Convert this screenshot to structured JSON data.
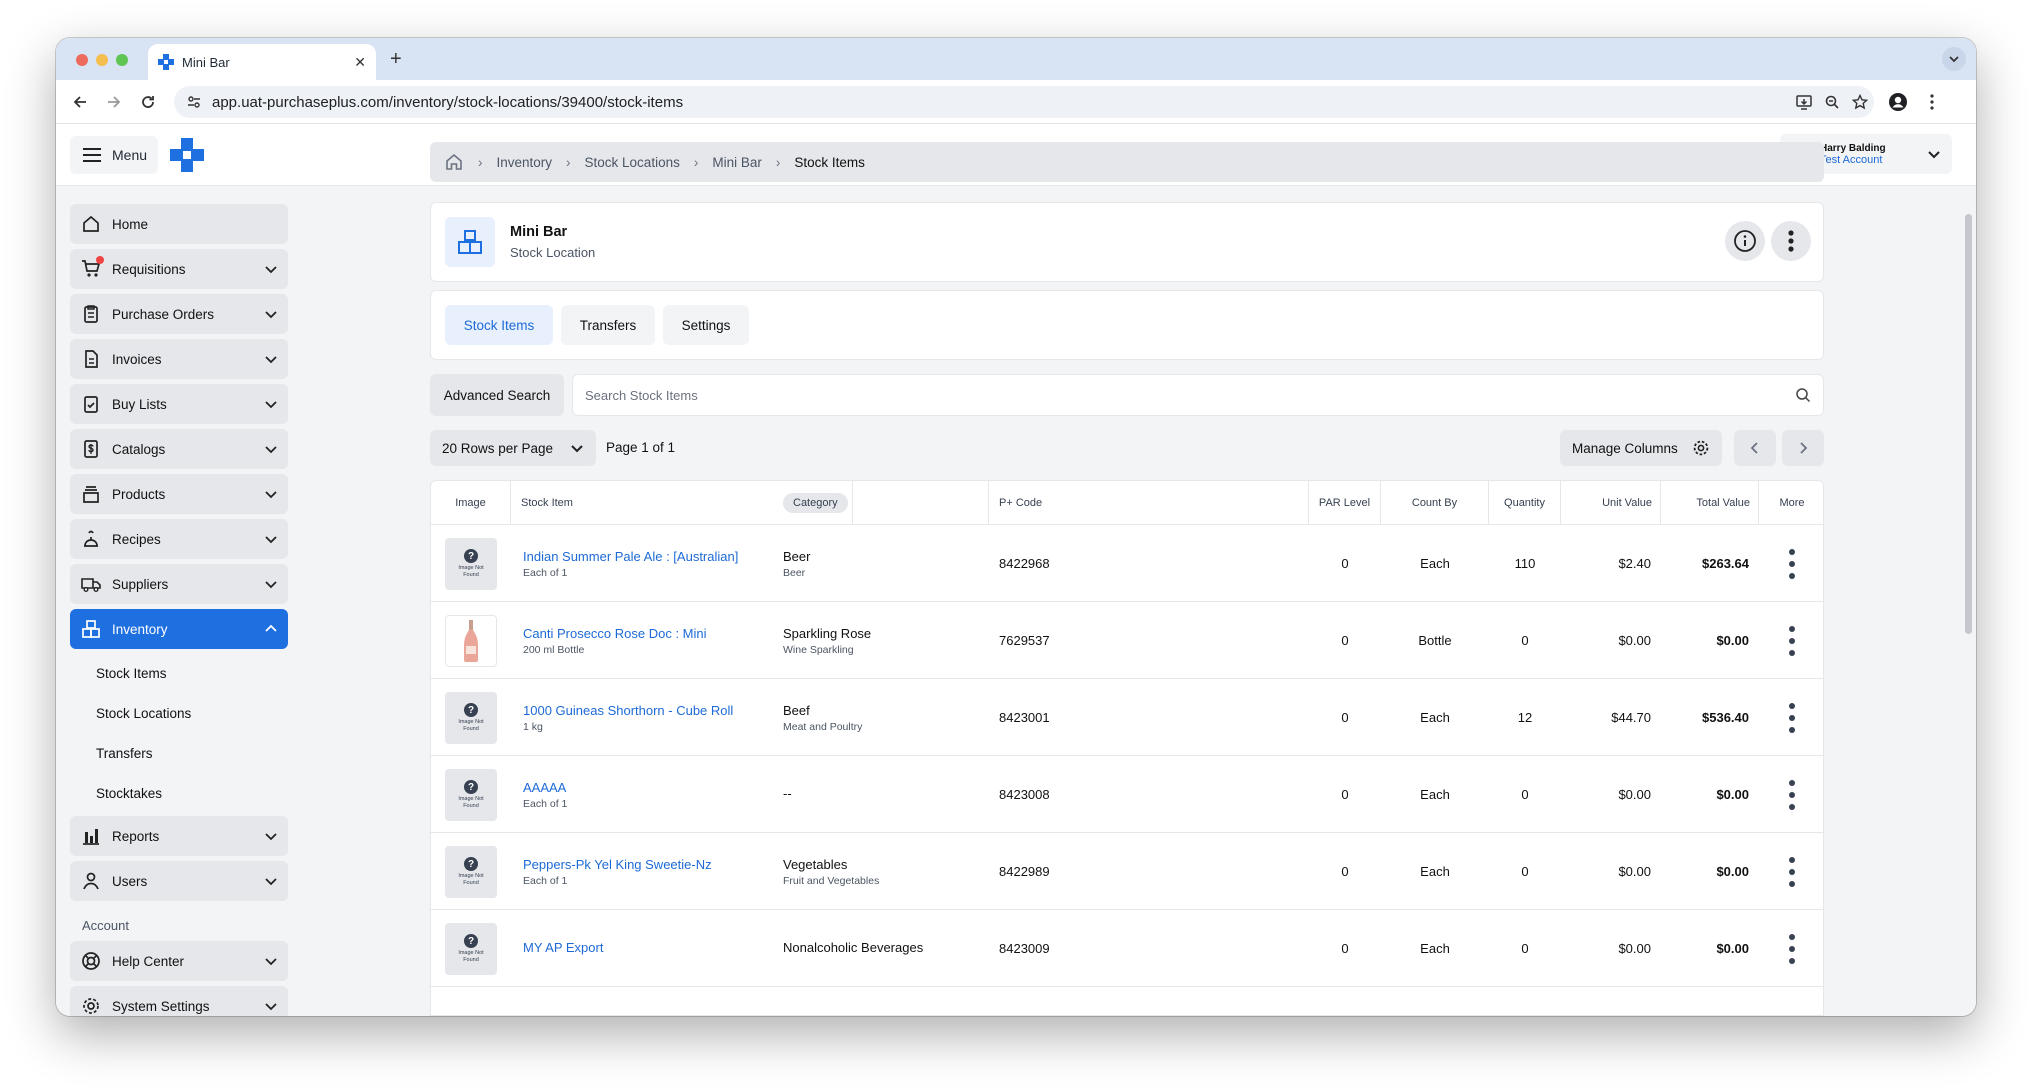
{
  "browser": {
    "tab_title": "Mini Bar",
    "url": "app.uat-purchaseplus.com/inventory/stock-locations/39400/stock-items"
  },
  "header": {
    "menu_label": "Menu",
    "user_name": "Harry Balding",
    "user_account": "Test Account"
  },
  "sidebar": {
    "items": [
      {
        "label": "Home",
        "icon": "home-icon"
      },
      {
        "label": "Requisitions",
        "icon": "cart-icon"
      },
      {
        "label": "Purchase Orders",
        "icon": "clipboard-icon"
      },
      {
        "label": "Invoices",
        "icon": "invoice-icon"
      },
      {
        "label": "Buy Lists",
        "icon": "checklist-icon"
      },
      {
        "label": "Catalogs",
        "icon": "dollar-doc-icon"
      },
      {
        "label": "Products",
        "icon": "box-stack-icon"
      },
      {
        "label": "Recipes",
        "icon": "chef-icon"
      },
      {
        "label": "Suppliers",
        "icon": "truck-icon"
      },
      {
        "label": "Inventory",
        "icon": "inventory-icon"
      }
    ],
    "inventory_sub": [
      "Stock Items",
      "Stock Locations",
      "Transfers",
      "Stocktakes"
    ],
    "more_items": [
      {
        "label": "Reports",
        "icon": "bar-chart-icon"
      },
      {
        "label": "Users",
        "icon": "user-icon"
      }
    ],
    "account_label": "Account",
    "account_items": [
      {
        "label": "Help Center",
        "icon": "lifebuoy-icon"
      },
      {
        "label": "System Settings",
        "icon": "gear-icon"
      }
    ]
  },
  "breadcrumb": [
    "Inventory",
    "Stock Locations",
    "Mini Bar",
    "Stock Items"
  ],
  "location": {
    "title": "Mini Bar",
    "subtitle": "Stock Location"
  },
  "tabs": [
    "Stock Items",
    "Transfers",
    "Settings"
  ],
  "toolbar": {
    "advanced_search": "Advanced Search",
    "search_placeholder": "Search Stock Items",
    "rows_per_page": "20 Rows per Page",
    "page_info": "Page 1 of 1",
    "manage_columns": "Manage Columns"
  },
  "table": {
    "headers": {
      "image": "Image",
      "stock_item": "Stock Item",
      "category": "Category",
      "pcode": "P+ Code",
      "par": "PAR Level",
      "count_by": "Count By",
      "quantity": "Quantity",
      "unit_value": "Unit Value",
      "total_value": "Total Value",
      "more": "More"
    },
    "not_found_text": "Image Not Found",
    "rows": [
      {
        "name": "Indian Summer Pale Ale : [Australian]",
        "sub": "Each of 1",
        "cat": "Beer",
        "subcat": "Beer",
        "code": "8422968",
        "par": "0",
        "count_by": "Each",
        "qty": "110",
        "unit": "$2.40",
        "total": "$263.64",
        "image": "not-found"
      },
      {
        "name": "Canti Prosecco Rose Doc : Mini",
        "sub": "200 ml Bottle",
        "cat": "Sparkling Rose",
        "subcat": "Wine Sparkling",
        "code": "7629537",
        "par": "0",
        "count_by": "Bottle",
        "qty": "0",
        "unit": "$0.00",
        "total": "$0.00",
        "image": "bottle"
      },
      {
        "name": "1000 Guineas Shorthorn - Cube Roll",
        "sub": "1 kg",
        "cat": "Beef",
        "subcat": "Meat and Poultry",
        "code": "8423001",
        "par": "0",
        "count_by": "Each",
        "qty": "12",
        "unit": "$44.70",
        "total": "$536.40",
        "image": "not-found"
      },
      {
        "name": "AAAAA",
        "sub": "Each of 1",
        "cat": "--",
        "subcat": "",
        "code": "8423008",
        "par": "0",
        "count_by": "Each",
        "qty": "0",
        "unit": "$0.00",
        "total": "$0.00",
        "image": "not-found"
      },
      {
        "name": "Peppers-Pk Yel King Sweetie-Nz",
        "sub": "Each of 1",
        "cat": "Vegetables",
        "subcat": "Fruit and Vegetables",
        "code": "8422989",
        "par": "0",
        "count_by": "Each",
        "qty": "0",
        "unit": "$0.00",
        "total": "$0.00",
        "image": "not-found"
      },
      {
        "name": "MY AP Export",
        "sub": "",
        "cat": "Nonalcoholic Beverages",
        "subcat": "",
        "code": "8423009",
        "par": "0",
        "count_by": "Each",
        "qty": "0",
        "unit": "$0.00",
        "total": "$0.00",
        "image": "not-found"
      }
    ]
  },
  "colors": {
    "accent": "#1e6fe0",
    "link": "#1d6ad6",
    "notification_dot": "#ef4444"
  }
}
